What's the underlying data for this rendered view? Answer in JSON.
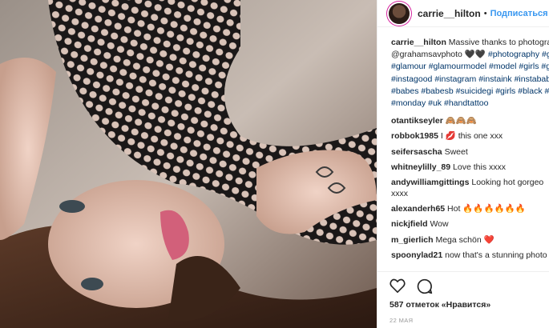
{
  "post": {
    "username": "carrie__hilton",
    "dot": "•",
    "follow_label": "Подписаться"
  },
  "caption": {
    "username": "carrie__hilton",
    "text": "Massive thanks to photographer",
    "mention": "@grahamsavphoto",
    "emoji": "🖤🖤",
    "hashtags": [
      "#photography",
      "#glam",
      "#glamour",
      "#glamourmodel",
      "#model",
      "#girls",
      "#girl",
      "# pi",
      "#instagood",
      "#instagram",
      "#instaink",
      "#instababes",
      "#babes",
      "#babesb",
      "#suicidegi",
      "#girls",
      "#black",
      "#red",
      "#monday",
      "#uk",
      "#handtattoo"
    ]
  },
  "comments": [
    {
      "user": "otantikseyler",
      "text": "🙈🙈🙈"
    },
    {
      "user": "robbok1985",
      "text": "I 💋 this one xxx"
    },
    {
      "user": "seifersascha",
      "text": "Sweet"
    },
    {
      "user": "whitneylilly_89",
      "text": "Love this xxxx"
    },
    {
      "user": "andywilliamgittings",
      "text": "Looking hot gorgeo xxxx"
    },
    {
      "user": "alexanderh65",
      "text": "Hot 🔥🔥🔥🔥🔥🔥"
    },
    {
      "user": "nickjfield",
      "text": "Wow"
    },
    {
      "user": "m_gierlich",
      "text": "Mega schön ❤️"
    },
    {
      "user": "spoonylad21",
      "text": "now that's a stunning photo"
    }
  ],
  "actions": {
    "icons": [
      "heart-icon",
      "comment-icon"
    ],
    "likes_label": "587 отметок «Нравится»",
    "date_label": "22 МАЯ"
  }
}
